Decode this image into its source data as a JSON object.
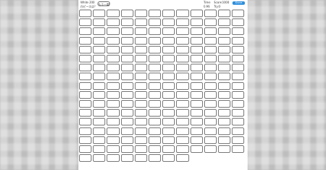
{
  "header": {
    "mode_label": "White 200",
    "hint_text": "白ピースは？",
    "start_button": "もう一度",
    "time_label": "Time",
    "time_value": "0.96",
    "score_label": "Score:",
    "score_value": "1000",
    "try_label": "Try:",
    "try_value": "0",
    "share_button": "Share"
  },
  "grid": {
    "columns": 12,
    "rows": 17,
    "tile_count": 200,
    "tile_color": "#ffffff",
    "tile_border": "#6f6f6f"
  },
  "colors": {
    "background": "#b9b9b9",
    "panel": "#ffffff",
    "share_button": "#2f8fdc"
  }
}
